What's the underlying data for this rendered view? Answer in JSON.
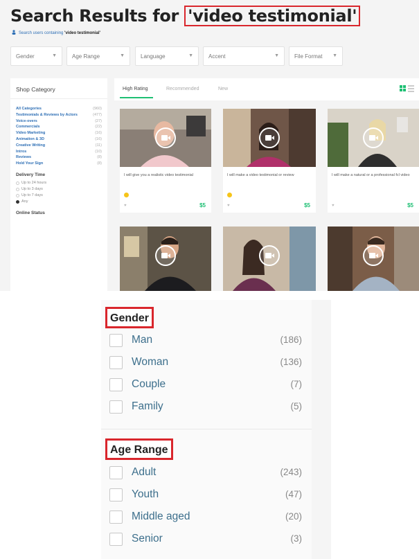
{
  "header": {
    "title_prefix": "Search Results for ",
    "query": "'video testimonial'",
    "sub_prefix": "Search users containing ",
    "sub_query": "'video testimonial'"
  },
  "filters": [
    "Gender",
    "Age Range",
    "Language",
    "Accent",
    "File Format"
  ],
  "sidebar": {
    "heading": "Shop Category",
    "categories": [
      {
        "label": "All Categories",
        "count": "(960)"
      },
      {
        "label": "Testimonials & Reviews by Actors",
        "count": "(477)"
      },
      {
        "label": "Voice-overs",
        "count": "(27)"
      },
      {
        "label": "Commercials",
        "count": "(22)"
      },
      {
        "label": "Video Marketing",
        "count": "(16)"
      },
      {
        "label": "Animation & 3D",
        "count": "(16)"
      },
      {
        "label": "Creative Writing",
        "count": "(11)"
      },
      {
        "label": "Intros",
        "count": "(10)"
      },
      {
        "label": "Reviews",
        "count": "(8)"
      },
      {
        "label": "Hold Your Sign",
        "count": "(8)"
      }
    ],
    "delivery_title": "Delivery Time",
    "delivery_options": [
      "Up to 24 hours",
      "Up to 3 days",
      "Up to 7 days",
      "Any"
    ],
    "delivery_selected": 3,
    "online_title": "Online Status"
  },
  "tabs": [
    "High Rating",
    "Recommended",
    "New"
  ],
  "active_tab": 0,
  "cards": [
    {
      "title": "I will give you a realistic video testimonial",
      "price": "$5",
      "badge": true
    },
    {
      "title": "I will make a video testimonial or review",
      "price": "$5",
      "badge": true
    },
    {
      "title": "I will make a natural or a professional fcl video",
      "price": "$5",
      "badge": false
    },
    {
      "title": "",
      "price": "",
      "badge": false
    },
    {
      "title": "",
      "price": "",
      "badge": false
    },
    {
      "title": "",
      "price": "",
      "badge": false
    }
  ],
  "panel": {
    "gender_label": "Gender",
    "gender": [
      {
        "label": "Man",
        "count": "(186)"
      },
      {
        "label": "Woman",
        "count": "(136)"
      },
      {
        "label": "Couple",
        "count": "(7)"
      },
      {
        "label": "Family",
        "count": "(5)"
      }
    ],
    "age_label": "Age Range",
    "age": [
      {
        "label": "Adult",
        "count": "(243)"
      },
      {
        "label": "Youth",
        "count": "(47)"
      },
      {
        "label": "Middle aged",
        "count": "(20)"
      },
      {
        "label": "Senior",
        "count": "(3)"
      }
    ]
  },
  "colors": {
    "accent_green": "#1dbf73",
    "highlight_red": "#d9262c",
    "link_blue": "#2e6fb5"
  }
}
